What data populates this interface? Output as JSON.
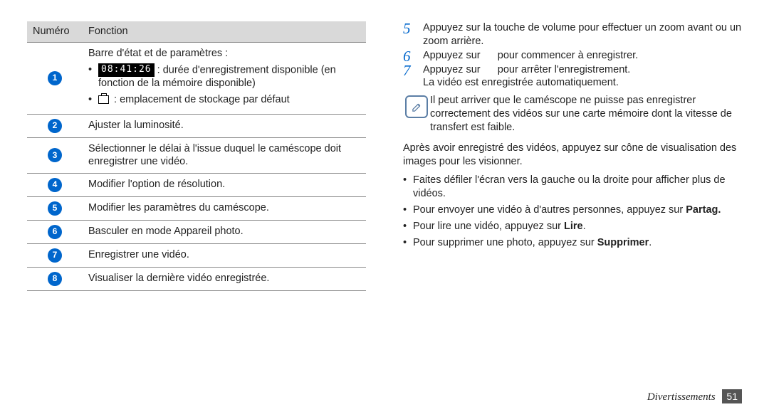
{
  "table": {
    "header_num": "Numéro",
    "header_fun": "Fonction",
    "row1": {
      "title": "Barre d'état et de paramètres :",
      "timer": "08:41:26",
      "b1_after": " : durée d'enregistrement disponible (en fonction de la mémoire disponible)",
      "b2": " : emplacement de stockage par défaut"
    },
    "row2": "Ajuster la luminosité.",
    "row3": "Sélectionner le délai à l'issue duquel le caméscope doit enregistrer une vidéo.",
    "row4": "Modifier l'option de résolution.",
    "row5": "Modifier les paramètres du caméscope.",
    "row6": "Basculer en mode Appareil photo.",
    "row7": "Enregistrer une vidéo.",
    "row8": "Visualiser la dernière vidéo enregistrée."
  },
  "steps": {
    "s5": "Appuyez sur la touche de volume pour effectuer un zoom avant ou un zoom arrière.",
    "s6a": "Appuyez sur ",
    "s6b": " pour commencer à enregistrer.",
    "s7a": "Appuyez sur ",
    "s7b": " pour arrêter l'enregistrement.",
    "s7c": "La vidéo est enregistrée automatiquement."
  },
  "note": "Il peut arriver que le caméscope ne puisse pas enregistrer correctement des vidéos sur une carte mémoire dont la vitesse de transfert est faible.",
  "para_after": "Après avoir enregistré des vidéos, appuyez sur cône de visualisation des images pour les visionner.",
  "tips": {
    "t1": "Faites défiler l'écran vers la gauche ou la droite pour afficher plus de vidéos.",
    "t2a": "Pour envoyer une vidéo à d'autres personnes, appuyez sur ",
    "t2b": "Partag.",
    "t3a": "Pour lire une vidéo, appuyez sur ",
    "t3b": "Lire",
    "t3c": ".",
    "t4a": "Pour supprimer une photo, appuyez sur ",
    "t4b": "Supprimer",
    "t4c": "."
  },
  "footer": {
    "section": "Divertissements",
    "page": "51"
  }
}
